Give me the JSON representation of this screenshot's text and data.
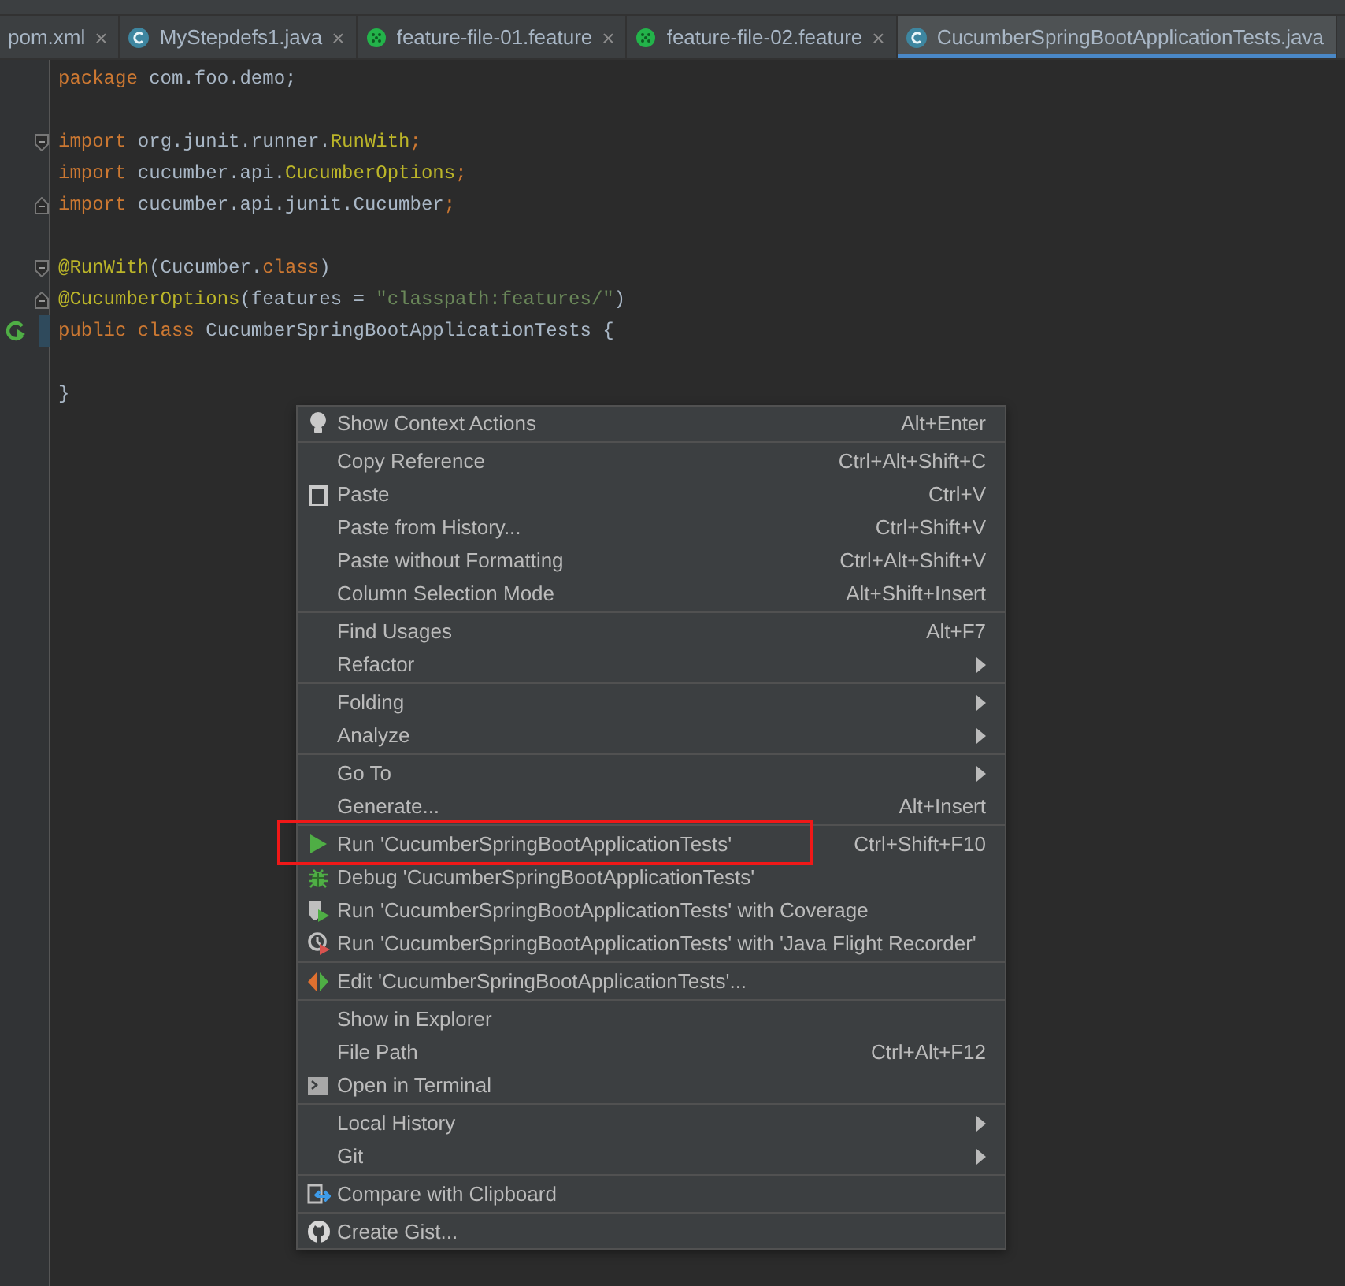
{
  "tabs": [
    {
      "label": "pom.xml",
      "kind": "xml",
      "selected": false,
      "closable": true
    },
    {
      "label": "MyStepdefs1.java",
      "kind": "class",
      "selected": false,
      "closable": true
    },
    {
      "label": "feature-file-01.feature",
      "kind": "feature",
      "selected": false,
      "closable": true
    },
    {
      "label": "feature-file-02.feature",
      "kind": "feature",
      "selected": false,
      "closable": true
    },
    {
      "label": "CucumberSpringBootApplicationTests.java",
      "kind": "class",
      "selected": true,
      "closable": false
    }
  ],
  "close_glyph": "×",
  "editor": {
    "lines": [
      {
        "kind": "plain",
        "tokens": [
          {
            "text": "package ",
            "kind": "keyword"
          },
          {
            "text": "com.foo.demo;",
            "kind": "plain"
          }
        ]
      },
      {
        "kind": "blank"
      },
      {
        "kind": "fold-start",
        "tokens": [
          {
            "text": "import ",
            "kind": "keyword"
          },
          {
            "text": "org.junit.runner.",
            "kind": "plain"
          },
          {
            "text": "RunWith",
            "kind": "annotation"
          },
          {
            "text": ";",
            "kind": "keyword"
          }
        ]
      },
      {
        "kind": "plain",
        "tokens": [
          {
            "text": "import ",
            "kind": "keyword"
          },
          {
            "text": "cucumber.api.",
            "kind": "plain"
          },
          {
            "text": "CucumberOptions",
            "kind": "annotation"
          },
          {
            "text": ";",
            "kind": "keyword"
          }
        ]
      },
      {
        "kind": "fold-end",
        "tokens": [
          {
            "text": "import ",
            "kind": "keyword"
          },
          {
            "text": "cucumber.api.junit.Cucumber",
            "kind": "plain"
          },
          {
            "text": ";",
            "kind": "keyword"
          }
        ]
      },
      {
        "kind": "blank"
      },
      {
        "kind": "fold-start",
        "tokens": [
          {
            "text": "@RunWith",
            "kind": "annotation"
          },
          {
            "text": "(Cucumber.",
            "kind": "plain"
          },
          {
            "text": "class",
            "kind": "keyword"
          },
          {
            "text": ")",
            "kind": "plain"
          }
        ]
      },
      {
        "kind": "fold-end",
        "tokens": [
          {
            "text": "@CucumberOptions",
            "kind": "annotation"
          },
          {
            "text": "(features = ",
            "kind": "plain"
          },
          {
            "text": "\"classpath:features/\"",
            "kind": "string"
          },
          {
            "text": ")",
            "kind": "plain"
          }
        ]
      },
      {
        "kind": "run",
        "tokens": [
          {
            "text": "public class ",
            "kind": "keyword"
          },
          {
            "text": "CucumberSpringBootApplicationTests {",
            "kind": "plain"
          }
        ]
      },
      {
        "kind": "blank"
      },
      {
        "kind": "plain",
        "tokens": [
          {
            "text": "}",
            "kind": "plain"
          }
        ]
      }
    ]
  },
  "context_menu": {
    "groups": [
      [
        {
          "label": "Show Context Actions",
          "shortcut": "Alt+Enter",
          "kind": "bulb",
          "submenu": false
        }
      ],
      [
        {
          "label": "Copy Reference",
          "shortcut": "Ctrl+Alt+Shift+C",
          "kind": "plain",
          "submenu": false
        },
        {
          "label": "Paste",
          "shortcut": "Ctrl+V",
          "kind": "clipboard",
          "submenu": false
        },
        {
          "label": "Paste from History...",
          "shortcut": "Ctrl+Shift+V",
          "kind": "plain",
          "submenu": false
        },
        {
          "label": "Paste without Formatting",
          "shortcut": "Ctrl+Alt+Shift+V",
          "kind": "plain",
          "submenu": false
        },
        {
          "label": "Column Selection Mode",
          "shortcut": "Alt+Shift+Insert",
          "kind": "plain",
          "submenu": false
        }
      ],
      [
        {
          "label": "Find Usages",
          "shortcut": "Alt+F7",
          "kind": "plain",
          "submenu": false
        },
        {
          "label": "Refactor",
          "kind": "plain",
          "submenu": true
        }
      ],
      [
        {
          "label": "Folding",
          "kind": "plain",
          "submenu": true
        },
        {
          "label": "Analyze",
          "kind": "plain",
          "submenu": true
        }
      ],
      [
        {
          "label": "Go To",
          "kind": "plain",
          "submenu": true
        },
        {
          "label": "Generate...",
          "shortcut": "Alt+Insert",
          "kind": "plain",
          "submenu": false
        }
      ],
      [
        {
          "label": "Run 'CucumberSpringBootApplicationTests'",
          "shortcut": "Ctrl+Shift+F10",
          "kind": "run",
          "submenu": false
        },
        {
          "label": "Debug 'CucumberSpringBootApplicationTests'",
          "kind": "debug",
          "submenu": false
        },
        {
          "label": "Run 'CucumberSpringBootApplicationTests' with Coverage",
          "kind": "coverage",
          "submenu": false
        },
        {
          "label": "Run 'CucumberSpringBootApplicationTests' with 'Java Flight Recorder'",
          "kind": "profiler",
          "submenu": false
        }
      ],
      [
        {
          "label": "Edit 'CucumberSpringBootApplicationTests'...",
          "kind": "edit",
          "submenu": false
        }
      ],
      [
        {
          "label": "Show in Explorer",
          "kind": "plain",
          "submenu": false
        },
        {
          "label": "File Path",
          "shortcut": "Ctrl+Alt+F12",
          "kind": "plain",
          "submenu": false
        },
        {
          "label": "Open in Terminal",
          "kind": "terminal",
          "submenu": false
        }
      ],
      [
        {
          "label": "Local History",
          "kind": "plain",
          "submenu": true
        },
        {
          "label": "Git",
          "kind": "plain",
          "submenu": true
        }
      ],
      [
        {
          "label": "Compare with Clipboard",
          "kind": "compare",
          "submenu": false
        }
      ],
      [
        {
          "label": "Create Gist...",
          "kind": "github",
          "submenu": false
        }
      ]
    ]
  }
}
